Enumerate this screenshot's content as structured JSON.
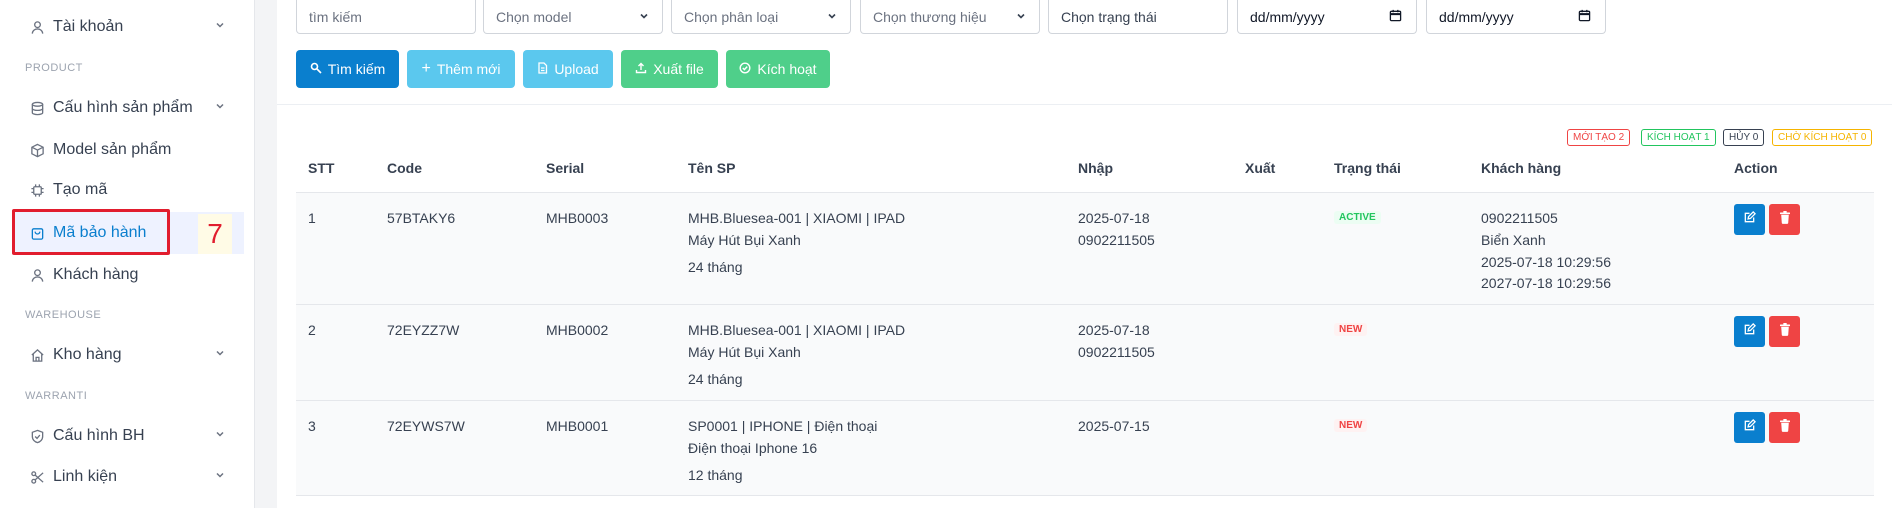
{
  "sidebar": {
    "items": [
      {
        "label": "Tài khoản",
        "icon": "user-icon"
      },
      {
        "label": "Cấu hình sản phẩm",
        "icon": "database-icon"
      },
      {
        "label": "Model sản phẩm",
        "icon": "cube-icon"
      },
      {
        "label": "Tạo mã",
        "icon": "chip-icon"
      },
      {
        "label": "Mã bảo hành",
        "icon": "shopping-bag-icon"
      },
      {
        "label": "Khách hàng",
        "icon": "user-icon"
      },
      {
        "label": "Kho hàng",
        "icon": "home-icon"
      },
      {
        "label": "Cấu hình BH",
        "icon": "shield-icon"
      },
      {
        "label": "Linh kiện",
        "icon": "scissors-icon"
      }
    ],
    "sections": [
      "PRODUCT",
      "WAREHOUSE",
      "WARRANTI"
    ],
    "annotation": "7"
  },
  "filters": {
    "search_placeholder": "tìm kiếm",
    "model": "Chọn model",
    "category": "Chọn phân loại",
    "brand": "Chọn thương hiệu",
    "status": "Chọn trạng thái",
    "date_from": "dd/mm/yyyy",
    "date_to": "dd/mm/yyyy"
  },
  "buttons": {
    "search": "Tìm kiếm",
    "add": "Thêm mới",
    "upload": "Upload",
    "export": "Xuất file",
    "activate": "Kích hoạt"
  },
  "badges": {
    "new": "MỚI TẠO 2",
    "active": "KÍCH HOẠT 1",
    "cancel": "HỦY 0",
    "pending": "CHỜ KÍCH HOẠT 0"
  },
  "table": {
    "headers": [
      "STT",
      "Code",
      "Serial",
      "Tên SP",
      "Nhập",
      "Xuất",
      "Trạng thái",
      "Khách hàng",
      "Action"
    ],
    "rows": [
      {
        "stt": "1",
        "code": "57BTAKY6",
        "serial": "MHB0003",
        "product": [
          "MHB.Bluesea-001 | XIAOMI | IPAD",
          "Máy Hút Bụi Xanh",
          "24 tháng"
        ],
        "import": [
          "2025-07-18",
          "0902211505"
        ],
        "export": "",
        "status": "ACTIVE",
        "customer": [
          "0902211505",
          "Biển Xanh",
          "2025-07-18 10:29:56",
          "2027-07-18 10:29:56"
        ]
      },
      {
        "stt": "2",
        "code": "72EYZZ7W",
        "serial": "MHB0002",
        "product": [
          "MHB.Bluesea-001 | XIAOMI | IPAD",
          "Máy Hút Bụi Xanh",
          "24 tháng"
        ],
        "import": [
          "2025-07-18",
          "0902211505"
        ],
        "export": "",
        "status": "NEW",
        "customer": []
      },
      {
        "stt": "3",
        "code": "72EYWS7W",
        "serial": "MHB0001",
        "product": [
          "SP0001 | IPHONE | Điện thoại",
          "Điện thoại Iphone 16",
          "12 tháng"
        ],
        "import": [
          "2025-07-15"
        ],
        "export": "",
        "status": "NEW",
        "customer": []
      }
    ]
  },
  "colors": {
    "primary": "#0a7fce",
    "primary_light": "#5bc8ee",
    "success": "#4fcf8a",
    "danger": "#ef4444",
    "highlight_red": "#e11d2e"
  }
}
